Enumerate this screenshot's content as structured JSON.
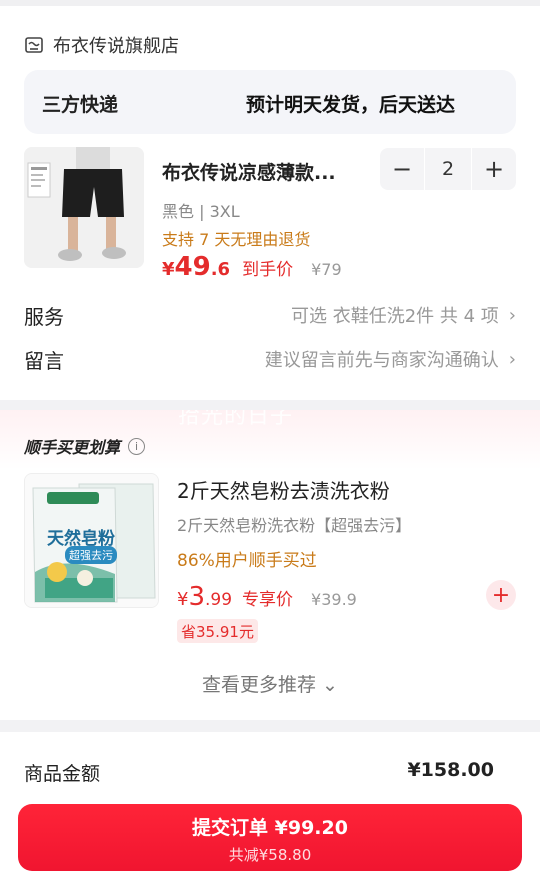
{
  "store": {
    "name": "布衣传说旗舰店",
    "icon": "store-icon"
  },
  "shipping": {
    "type": "三方快递",
    "eta": "预计明天发货，后天送达"
  },
  "product": {
    "title": "布衣传说凉感薄款...",
    "spec": "黑色 | 3XL",
    "return_policy": "支持 7 天无理由退货",
    "price_yen": "¥",
    "price_int": "49",
    "price_dec": ".6",
    "price_label": "到手价",
    "original_price": "¥79",
    "quantity": "2",
    "minus": "−",
    "plus": "+"
  },
  "service": {
    "label": "服务",
    "value": "可选 衣鞋任洗2件 共 4 项"
  },
  "message": {
    "label": "留言",
    "placeholder": "建议留言前先与商家沟通确认"
  },
  "watermark": "拾光的日子",
  "recommend": {
    "title": "顺手买更划算",
    "item": {
      "title": "2斤天然皂粉去渍洗衣粉",
      "subtitle": "2斤天然皂粉洗衣粉【超强去污】",
      "buyers": "86%用户顺手买过",
      "price_yen": "¥",
      "price_int": "3",
      "price_dec": ".99",
      "price_label": "专享价",
      "original_price": "¥39.9",
      "save": "省35.91元",
      "package_text_1": "天然皂粉",
      "package_text_2": "超强去污"
    },
    "more": "查看更多推荐 ⌄"
  },
  "summary": {
    "label": "商品金额",
    "value": "¥158.00"
  },
  "submit": {
    "main": "提交订单  ¥99.20",
    "sub": "共减¥58.80"
  },
  "colors": {
    "accent": "#e42c2c",
    "gold": "#c97b1a",
    "submit": "#f01530"
  }
}
